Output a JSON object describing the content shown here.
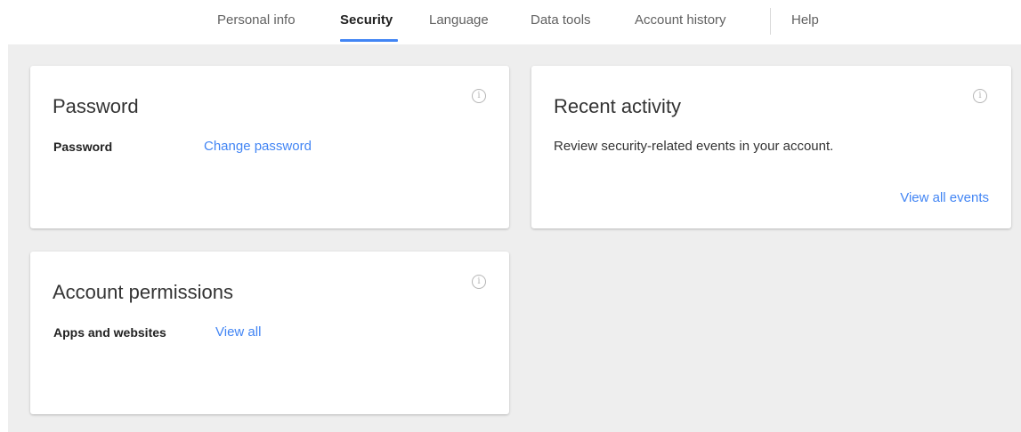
{
  "nav": {
    "tabs": [
      {
        "label": "Personal info"
      },
      {
        "label": "Security"
      },
      {
        "label": "Language"
      },
      {
        "label": "Data tools"
      },
      {
        "label": "Account history"
      },
      {
        "label": "Help"
      }
    ],
    "active_tab": "Security",
    "accent_color": "#4285f4"
  },
  "cards": {
    "password": {
      "title": "Password",
      "row_label": "Password",
      "action_link": "Change password",
      "info_icon": "info-icon"
    },
    "recent_activity": {
      "title": "Recent activity",
      "description": "Review security-related events in your account.",
      "action_link": "View all events",
      "info_icon": "info-icon"
    },
    "account_permissions": {
      "title": "Account permissions",
      "row_label": "Apps and websites",
      "action_link": "View all",
      "info_icon": "info-icon"
    }
  }
}
